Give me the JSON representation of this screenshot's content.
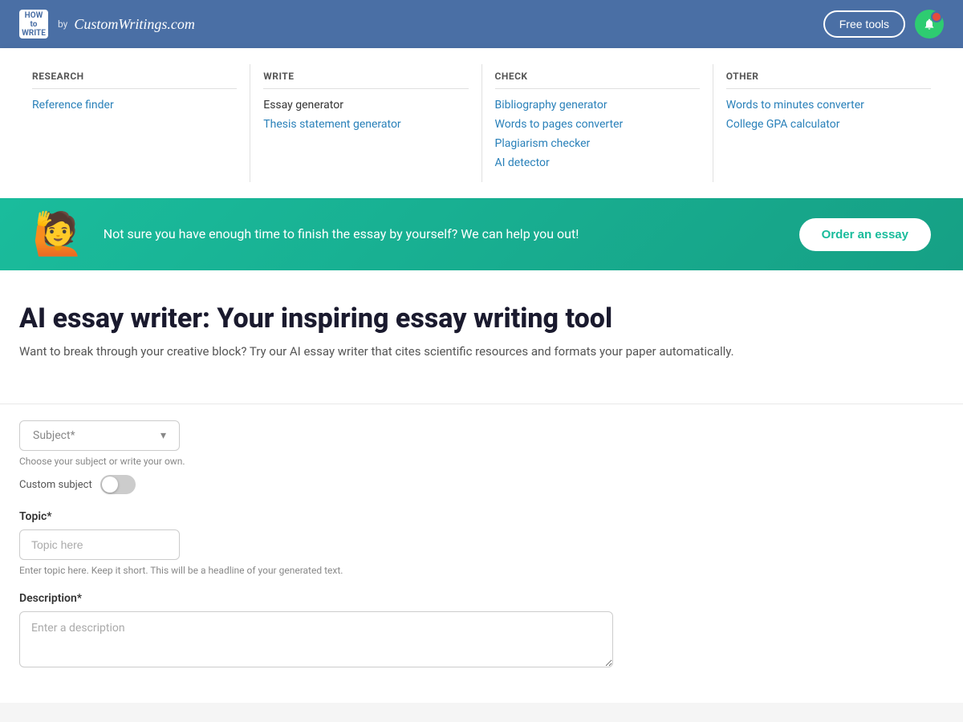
{
  "header": {
    "logo_text": "HOW to\nWRITE",
    "logo_by": "by",
    "logo_site": "CustomWritings.com",
    "free_tools_label": "Free tools",
    "notification_label": "🔔"
  },
  "nav": {
    "research": {
      "title": "RESEARCH",
      "links": [
        {
          "label": "Reference finder",
          "style": "blue"
        }
      ]
    },
    "write": {
      "title": "WRITE",
      "links": [
        {
          "label": "Essay generator",
          "style": "plain"
        },
        {
          "label": "Thesis statement generator",
          "style": "blue"
        }
      ]
    },
    "check": {
      "title": "CHECK",
      "links": [
        {
          "label": "Bibliography generator",
          "style": "blue"
        },
        {
          "label": "Words to pages converter",
          "style": "blue"
        },
        {
          "label": "Plagiarism checker",
          "style": "blue"
        },
        {
          "label": "AI detector",
          "style": "blue"
        }
      ]
    },
    "other": {
      "title": "OTHER",
      "links": [
        {
          "label": "Words to minutes converter",
          "style": "blue"
        },
        {
          "label": "College GPA calculator",
          "style": "blue"
        }
      ]
    }
  },
  "banner": {
    "emoji": "🙋",
    "text": "Not sure you have enough time to finish the essay by yourself? We can help you out!",
    "button_label": "Order an essay"
  },
  "main": {
    "title": "AI essay writer: Your inspiring essay writing tool",
    "subtitle": "Want to break through your creative block? Try our AI essay writer that cites scientific resources and formats your paper automatically."
  },
  "form": {
    "subject_placeholder": "Subject*",
    "subject_hint": "Choose your subject or write your own.",
    "custom_subject_label": "Custom subject",
    "topic_label": "Topic*",
    "topic_placeholder": "Topic here",
    "topic_hint": "Enter topic here. Keep it short. This will be a headline of your generated text.",
    "description_label": "Description*",
    "description_placeholder": "Enter a description"
  }
}
